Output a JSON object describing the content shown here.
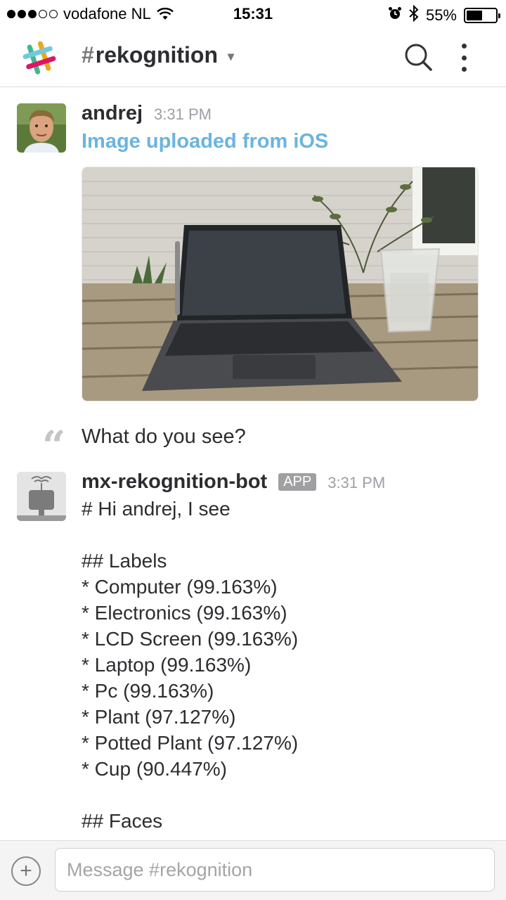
{
  "status_bar": {
    "carrier": "vodafone NL",
    "time": "15:31",
    "battery_percent": "55%",
    "battery_level": 0.55,
    "signal_bars_filled": 3,
    "signal_bars_total": 5,
    "icons": [
      "wifi-icon",
      "alarm-icon",
      "bluetooth-icon",
      "battery-icon"
    ]
  },
  "header": {
    "channel_hash": "#",
    "channel_name": "rekognition",
    "chevron": "⌄",
    "icons": [
      "slack-logo",
      "search-icon",
      "more-vertical-icon"
    ]
  },
  "messages": [
    {
      "sender": "andrej",
      "time": "3:31 PM",
      "link_text": "Image uploaded from iOS",
      "image_description_icon": "photo-laptop-on-table",
      "comment": "What do you see?"
    },
    {
      "sender": "mx-rekognition-bot",
      "badge": "APP",
      "time": "3:31 PM",
      "lines": [
        "# Hi andrej, I see",
        "",
        "## Labels",
        "* Computer (99.163%)",
        "* Electronics (99.163%)",
        "* LCD Screen (99.163%)",
        "* Laptop (99.163%)",
        "* Pc (99.163%)",
        "* Plant (97.127%)",
        "* Potted Plant (97.127%)",
        "* Cup (90.447%)",
        "",
        "## Faces"
      ]
    }
  ],
  "composer": {
    "plus_label": "+",
    "placeholder": "Message #rekognition"
  },
  "colors": {
    "link": "#6bb4e0",
    "timestamp": "#9e9ea6",
    "badge_bg": "#a0a0a2",
    "text": "#2c2d30"
  }
}
